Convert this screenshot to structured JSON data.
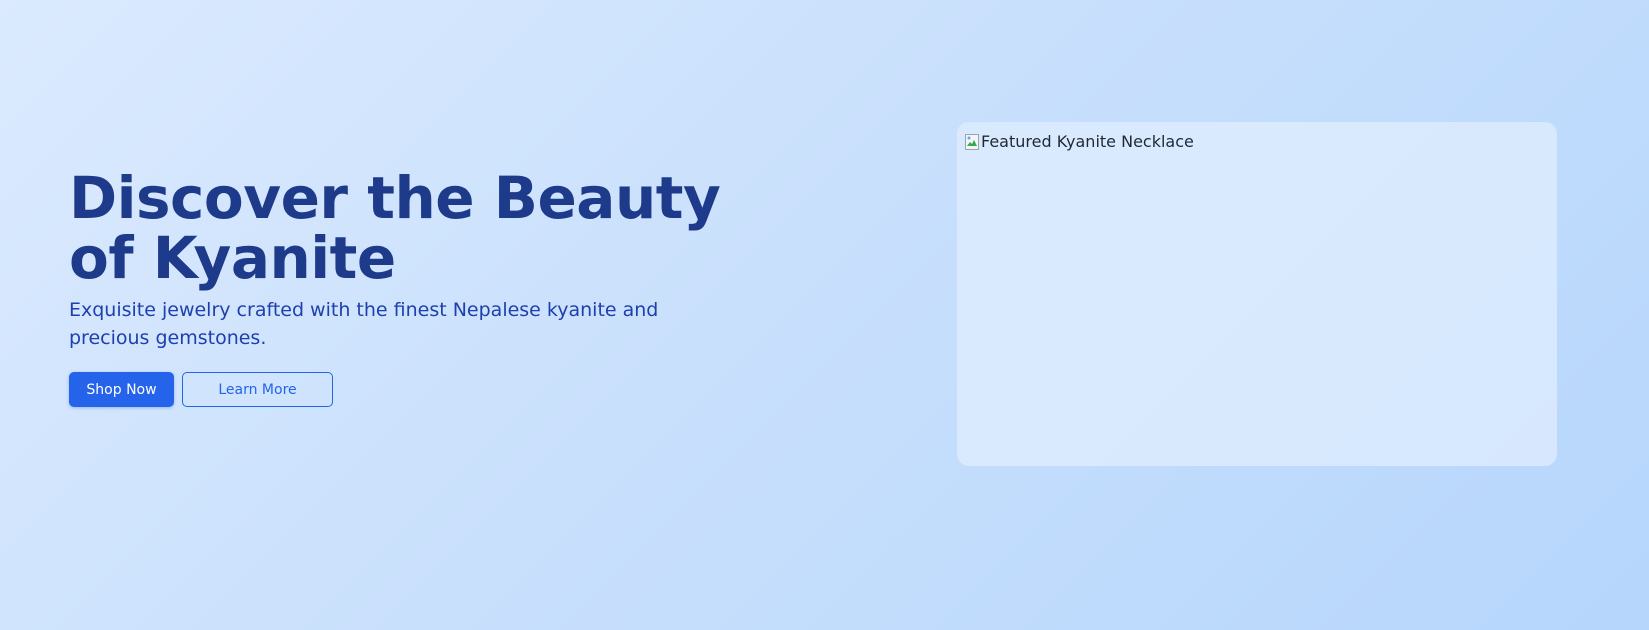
{
  "hero": {
    "title": "Discover the Beauty of Kyanite",
    "subtitle": "Exquisite jewelry crafted with the finest Nepalese kyanite and precious gemstones.",
    "primary_button": "Shop Now",
    "secondary_button": "Learn More"
  },
  "featured_image": {
    "alt_text": "Featured Kyanite Necklace",
    "icon": "broken-image-icon"
  },
  "colors": {
    "background_start": "#dbeafe",
    "background_end": "#b6d6fc",
    "heading": "#1e3a8a",
    "subtitle": "#1e40af",
    "accent": "#2563eb"
  }
}
